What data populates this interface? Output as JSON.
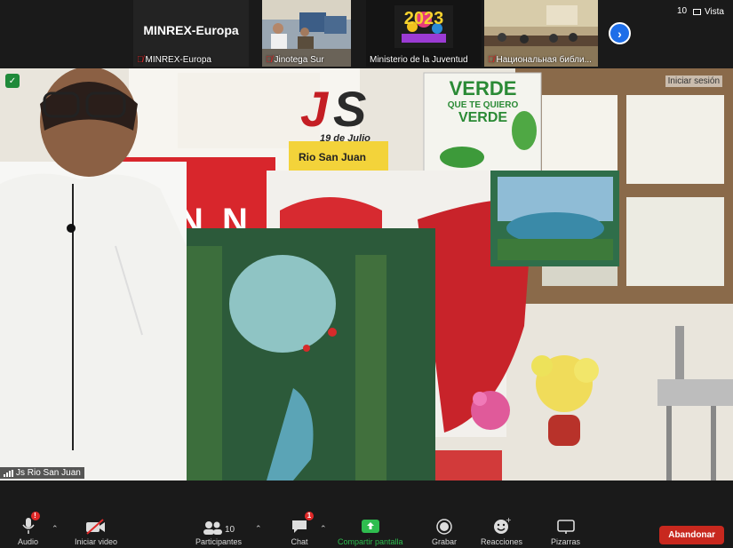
{
  "gallery": {
    "tiles": [
      {
        "name": "MINREX-Europa",
        "big_label": "MINREX-Europa",
        "muted": true
      },
      {
        "name": "Jinotega Sur",
        "muted": true
      },
      {
        "name": "Ministerio de la Juventud",
        "muted": false
      },
      {
        "name": "Национальная библи...",
        "muted": true
      }
    ],
    "tile_2023_label": "2023",
    "view_label": "Vista",
    "top_number": "10"
  },
  "main": {
    "login_label": "Iniciar sesión",
    "speaker_name": "Js Rio San Juan",
    "banner_letters": "JS",
    "banner_date": "19 de Julio",
    "banner_place": "Rio San Juan",
    "poster_line1": "VERDE",
    "poster_line2": "QUE TE QUIERO",
    "poster_line3": "VERDE"
  },
  "toolbar": {
    "audio": {
      "label": "Audio",
      "badge": "!"
    },
    "video": {
      "label": "Iniciar video"
    },
    "participants": {
      "label": "Participantes",
      "count": "10"
    },
    "chat": {
      "label": "Chat",
      "badge": "1"
    },
    "share": {
      "label": "Compartir pantalla"
    },
    "record": {
      "label": "Grabar"
    },
    "reactions": {
      "label": "Reacciones"
    },
    "whiteboards": {
      "label": "Pizarras"
    },
    "leave": {
      "label": "Abandonar"
    }
  },
  "colors": {
    "share_green": "#2fbd4f",
    "leave_red": "#c8281e",
    "badge_red": "#e02828",
    "accent_blue": "#1e6ee8"
  }
}
